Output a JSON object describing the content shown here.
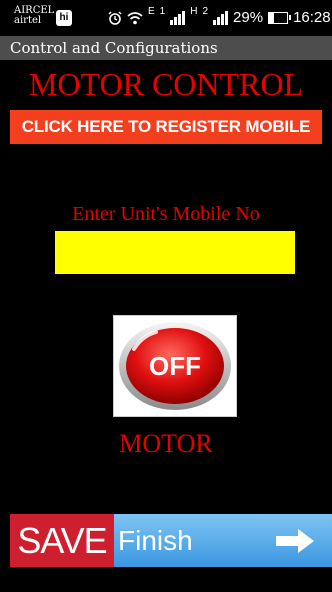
{
  "status": {
    "carrier_top": "AIRCEL",
    "carrier_bottom": "airtel",
    "app_badge": "hi",
    "net1_type": "E",
    "net1_slot": "1",
    "net2_type": "H",
    "net2_slot": "2",
    "battery": "29%",
    "time": "16:28"
  },
  "titlebar": {
    "title": "Control and Configurations"
  },
  "app": {
    "title": "MOTOR CONTROL",
    "register_label": "CLICK HERE TO REGISTER MOBILE",
    "mobile_label": "Enter Unit's Mobile No",
    "mobile_value": "",
    "mobile_placeholder": "",
    "toggle_state": "OFF",
    "motor_label": "MOTOR",
    "save_label": "SAVE",
    "finish_label": "Finish"
  },
  "colors": {
    "accent_red": "#e60000",
    "register_bg": "#f43f1f",
    "input_bg": "#ffff00",
    "save_bg": "#ce1f2f",
    "finish_bg": "#3a97e0"
  },
  "icons": [
    "alarm-icon",
    "wifi-icon",
    "signal-icon",
    "battery-icon",
    "arrow-right-icon"
  ]
}
